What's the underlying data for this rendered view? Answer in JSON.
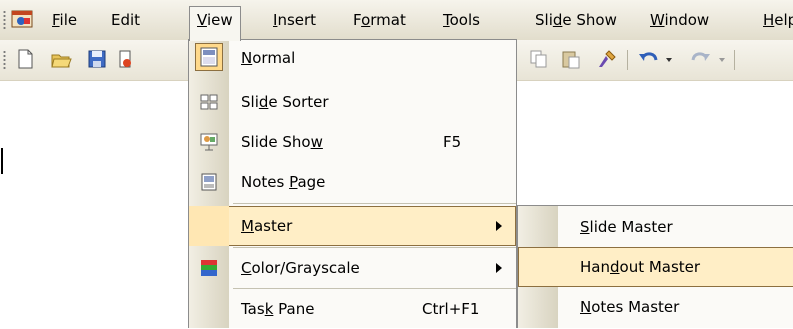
{
  "menubar": {
    "items": [
      {
        "pre": "",
        "key": "F",
        "post": "ile"
      },
      {
        "pre": "Edit",
        "key": "",
        "post": ""
      },
      {
        "pre": "",
        "key": "V",
        "post": "iew"
      },
      {
        "pre": "",
        "key": "I",
        "post": "nsert"
      },
      {
        "pre": "F",
        "key": "o",
        "post": "rmat"
      },
      {
        "pre": "",
        "key": "T",
        "post": "ools"
      },
      {
        "pre": "Sli",
        "key": "d",
        "post": "e Show"
      },
      {
        "pre": "",
        "key": "W",
        "post": "indow"
      },
      {
        "pre": "",
        "key": "H",
        "post": "elp"
      }
    ]
  },
  "view_menu": {
    "normal": {
      "pre": "",
      "key": "N",
      "post": "ormal"
    },
    "slide_sorter": {
      "pre": "Sli",
      "key": "d",
      "post": "e Sorter"
    },
    "slide_show": {
      "pre": "Slide Sho",
      "key": "w",
      "post": "",
      "shortcut": "F5"
    },
    "notes_page": {
      "pre": "Notes ",
      "key": "P",
      "post": "age"
    },
    "master": {
      "pre": "",
      "key": "M",
      "post": "aster"
    },
    "color_grayscale": {
      "pre": "",
      "key": "C",
      "post": "olor/Grayscale"
    },
    "task_pane": {
      "pre": "Tas",
      "key": "k",
      "post": " Pane",
      "shortcut": "Ctrl+F1"
    }
  },
  "master_submenu": {
    "slide_master": {
      "pre": "",
      "key": "S",
      "post": "lide Master"
    },
    "handout_master": {
      "pre": "Han",
      "key": "d",
      "post": "out Master"
    },
    "notes_master": {
      "pre": "",
      "key": "N",
      "post": "otes Master"
    }
  },
  "icons": {
    "app": "powerpoint-icon",
    "toolbar": [
      "new-icon",
      "open-icon",
      "save-icon",
      "permission-icon",
      "copy-icon",
      "paste-icon",
      "format-painter-icon",
      "undo-icon",
      "redo-icon"
    ]
  },
  "colors": {
    "highlight": "#ffeec6",
    "highlight_border": "#8c6f40"
  }
}
